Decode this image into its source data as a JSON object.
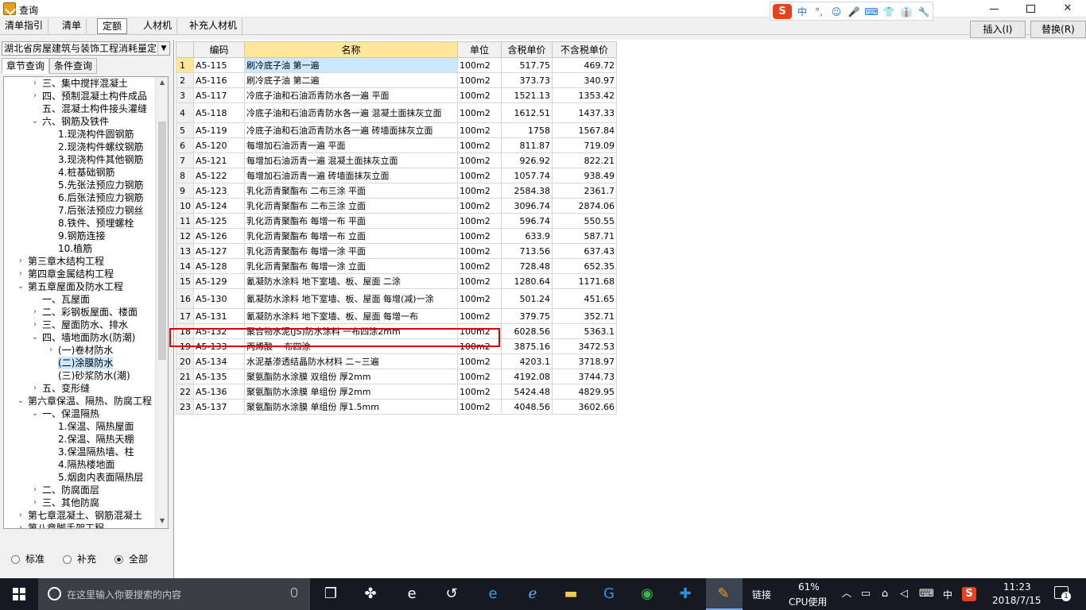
{
  "window": {
    "title": "查询"
  },
  "ime": {
    "logo": "S",
    "items": [
      "中",
      "°,",
      "☺",
      "🎤",
      "⌨",
      "👕",
      "👔",
      "🔧"
    ]
  },
  "tabs": [
    "清单指引",
    "清单",
    "定额",
    "人材机",
    "补充人材机"
  ],
  "active_tab": "定额",
  "toolbar": {
    "insert_label": "插入(I)",
    "replace_label": "替换(R)"
  },
  "left": {
    "library": "湖北省房屋建筑与装饰工程消耗量定",
    "tabs": [
      "章节查询",
      "条件查询"
    ],
    "tree": [
      {
        "label": "三、集中搅拌混凝土",
        "level": 2,
        "state": "collapsed"
      },
      {
        "label": "四、预制混凝土构件成品",
        "level": 2,
        "state": "collapsed"
      },
      {
        "label": "五、混凝土构件接头灌缝",
        "level": 2,
        "state": "leaf"
      },
      {
        "label": "六、钢筋及铁件",
        "level": 2,
        "state": "expanded"
      },
      {
        "label": "1.现浇构件圆钢筋",
        "level": 3,
        "state": "leaf"
      },
      {
        "label": "2.现浇构件螺纹钢筋",
        "level": 3,
        "state": "leaf"
      },
      {
        "label": "3.现浇构件其他钢筋",
        "level": 3,
        "state": "leaf"
      },
      {
        "label": "4.桩基础钢筋",
        "level": 3,
        "state": "leaf"
      },
      {
        "label": "5.先张法预应力钢筋",
        "level": 3,
        "state": "leaf"
      },
      {
        "label": "6.后张法预应力钢筋",
        "level": 3,
        "state": "leaf"
      },
      {
        "label": "7.后张法预应力钢丝",
        "level": 3,
        "state": "leaf"
      },
      {
        "label": "8.铁件、预埋螺栓",
        "level": 3,
        "state": "leaf"
      },
      {
        "label": "9.钢筋连接",
        "level": 3,
        "state": "leaf"
      },
      {
        "label": "10.植筋",
        "level": 3,
        "state": "leaf"
      },
      {
        "label": "第三章木结构工程",
        "level": 1,
        "state": "collapsed"
      },
      {
        "label": "第四章金属结构工程",
        "level": 1,
        "state": "collapsed"
      },
      {
        "label": "第五章屋面及防水工程",
        "level": 1,
        "state": "expanded"
      },
      {
        "label": "一、瓦屋面",
        "level": 2,
        "state": "leaf"
      },
      {
        "label": "二、彩钢板屋面、楼面",
        "level": 2,
        "state": "collapsed"
      },
      {
        "label": "三、屋面防水、排水",
        "level": 2,
        "state": "collapsed"
      },
      {
        "label": "四、墙地面防水(防潮)",
        "level": 2,
        "state": "expanded"
      },
      {
        "label": "(一)卷材防水",
        "level": 3,
        "state": "collapsed"
      },
      {
        "label": "(二)涂膜防水",
        "level": 3,
        "state": "selected"
      },
      {
        "label": "(三)砂浆防水(潮)",
        "level": 3,
        "state": "leaf"
      },
      {
        "label": "五、变形缝",
        "level": 2,
        "state": "collapsed"
      },
      {
        "label": "第六章保温、隔热、防腐工程",
        "level": 1,
        "state": "expanded"
      },
      {
        "label": "一、保温隔热",
        "level": 2,
        "state": "expanded"
      },
      {
        "label": "1.保温、隔热屋面",
        "level": 3,
        "state": "leaf"
      },
      {
        "label": "2.保温、隔热天棚",
        "level": 3,
        "state": "leaf"
      },
      {
        "label": "3.保温隔热墙、柱",
        "level": 3,
        "state": "leaf"
      },
      {
        "label": "4.隔热楼地面",
        "level": 3,
        "state": "leaf"
      },
      {
        "label": "5.烟囱内表面隔热层",
        "level": 3,
        "state": "leaf"
      },
      {
        "label": "二、防腐面层",
        "level": 2,
        "state": "collapsed"
      },
      {
        "label": "三、其他防腐",
        "level": 2,
        "state": "collapsed"
      },
      {
        "label": "第七章混凝土、钢筋混凝土",
        "level": 1,
        "state": "collapsed"
      },
      {
        "label": "第八章脚手架工程",
        "level": 1,
        "state": "collapsed"
      }
    ],
    "radios": [
      "标准",
      "补充",
      "全部"
    ],
    "radio_selected": "全部"
  },
  "grid": {
    "columns": [
      "",
      "编码",
      "名称",
      "单位",
      "含税单价",
      "不含税单价"
    ],
    "rows": [
      [
        "1",
        "A5-115",
        "刷冷底子油 第一遍",
        "100m2",
        "517.75",
        "469.72"
      ],
      [
        "2",
        "A5-116",
        "刷冷底子油 第二遍",
        "100m2",
        "373.73",
        "340.97"
      ],
      [
        "3",
        "A5-117",
        "冷底子油和石油沥青防水各一遍 平面",
        "100m2",
        "1521.13",
        "1353.42"
      ],
      [
        "4",
        "A5-118",
        "冷底子油和石油沥青防水各一遍 混凝土面抹灰立面",
        "100m2",
        "1612.51",
        "1437.33"
      ],
      [
        "5",
        "A5-119",
        "冷底子油和石油沥青防水各一遍 砖墙面抹灰立面",
        "100m2",
        "1758",
        "1567.84"
      ],
      [
        "6",
        "A5-120",
        "每增加石油沥青一遍 平面",
        "100m2",
        "811.87",
        "719.09"
      ],
      [
        "7",
        "A5-121",
        "每增加石油沥青一遍 混凝土面抹灰立面",
        "100m2",
        "926.92",
        "822.21"
      ],
      [
        "8",
        "A5-122",
        "每增加石油沥青一遍 砖墙面抹灰立面",
        "100m2",
        "1057.74",
        "938.49"
      ],
      [
        "9",
        "A5-123",
        "乳化沥青聚酯布 二布三涂 平面",
        "100m2",
        "2584.38",
        "2361.7"
      ],
      [
        "10",
        "A5-124",
        "乳化沥青聚酯布 二布三涂 立面",
        "100m2",
        "3096.74",
        "2874.06"
      ],
      [
        "11",
        "A5-125",
        "乳化沥青聚酯布 每增一布 平面",
        "100m2",
        "596.74",
        "550.55"
      ],
      [
        "12",
        "A5-126",
        "乳化沥青聚酯布 每增一布 立面",
        "100m2",
        "633.9",
        "587.71"
      ],
      [
        "13",
        "A5-127",
        "乳化沥青聚酯布 每增一涂 平面",
        "100m2",
        "713.56",
        "637.43"
      ],
      [
        "14",
        "A5-128",
        "乳化沥青聚酯布 每增一涂 立面",
        "100m2",
        "728.48",
        "652.35"
      ],
      [
        "15",
        "A5-129",
        "氰凝防水涂料 地下室墙、板、屋面 二涂",
        "100m2",
        "1280.64",
        "1171.68"
      ],
      [
        "16",
        "A5-130",
        "氰凝防水涂料 地下室墙、板、屋面 每增(减)一涂",
        "100m2",
        "501.24",
        "451.65"
      ],
      [
        "17",
        "A5-131",
        "氰凝防水涂料 地下室墙、板、屋面 每增一布",
        "100m2",
        "379.75",
        "352.71"
      ],
      [
        "18",
        "A5-132",
        "聚合物水泥(JS)防水涂料 一布四涂2mm",
        "100m2",
        "6028.56",
        "5363.1"
      ],
      [
        "19",
        "A5-133",
        "丙烯酸 一布四涂",
        "100m2",
        "3875.16",
        "3472.53"
      ],
      [
        "20",
        "A5-134",
        "水泥基渗透结晶防水材料 二~三遍",
        "100m2",
        "4203.1",
        "3718.97"
      ],
      [
        "21",
        "A5-135",
        "聚氨酯防水涂膜 双组份 厚2mm",
        "100m2",
        "4192.08",
        "3744.73"
      ],
      [
        "22",
        "A5-136",
        "聚氨酯防水涂膜 单组份 厚2mm",
        "100m2",
        "5424.48",
        "4829.95"
      ],
      [
        "23",
        "A5-137",
        "聚氨酯防水涂膜 单组份 厚1.5mm",
        "100m2",
        "4048.56",
        "3602.66"
      ]
    ],
    "tall_rows": [
      4,
      16
    ],
    "selected_row": 1,
    "highlighted_row": 18
  },
  "taskbar": {
    "search_placeholder": "在这里输入你要搜索的内容",
    "link_label": "链接",
    "cpu_percent": "61%",
    "cpu_label": "CPU使用",
    "ime_lang": "中",
    "time": "11:23",
    "date": "2018/7/15",
    "notifications": "1"
  },
  "colors": {
    "selection": "#cce8ff",
    "header_highlight": "#ffe699",
    "annotation": "#e00000",
    "taskbar": "#151a22"
  }
}
